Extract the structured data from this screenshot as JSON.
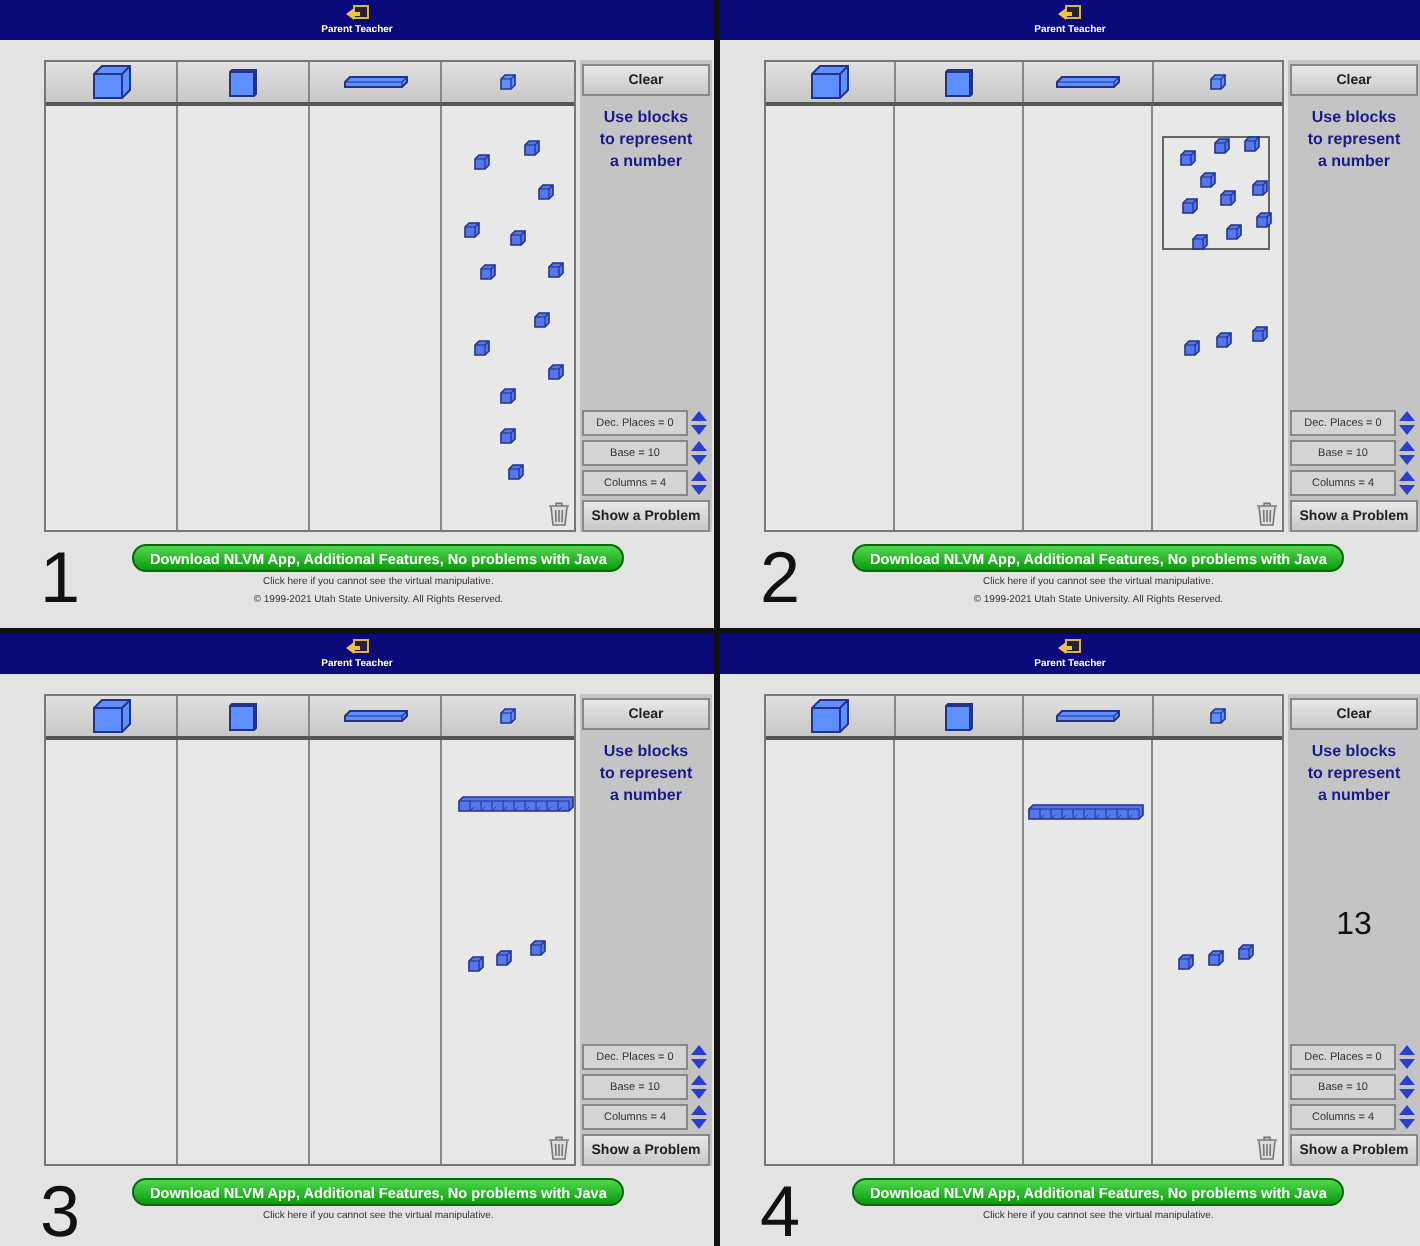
{
  "panels": [
    {
      "label": "1",
      "header": "Parent Teacher",
      "clear_button": "Clear",
      "message": "Use blocks to represent a number",
      "pieces": [
        {
          "kind": "unit"
        },
        {
          "kind": "unit"
        },
        {
          "kind": "unit"
        },
        {
          "kind": "unit"
        },
        {
          "kind": "unit"
        },
        {
          "kind": "unit"
        },
        {
          "kind": "unit"
        },
        {
          "kind": "unit"
        },
        {
          "kind": "unit"
        },
        {
          "kind": "unit"
        },
        {
          "kind": "unit"
        },
        {
          "kind": "unit"
        },
        {
          "kind": "unit"
        }
      ],
      "settings": [
        {
          "label": "Dec. Places = 0"
        },
        {
          "label": "Base = 10"
        },
        {
          "label": "Columns = 4"
        }
      ],
      "problem_button": "Show a Problem",
      "download_button": "Download NLVM App, Additional Features, No problems with Java",
      "notes": [
        "Click here if you cannot see the virtual manipulative.",
        "© 1999-2021 Utah State University. All Rights Reserved."
      ]
    },
    {
      "label": "2",
      "header": "Parent Teacher",
      "clear_button": "Clear",
      "message": "Use blocks to represent a number",
      "selection_box": true,
      "pieces": [
        {
          "kind": "unit"
        },
        {
          "kind": "unit"
        },
        {
          "kind": "unit"
        },
        {
          "kind": "unit"
        },
        {
          "kind": "unit"
        },
        {
          "kind": "unit"
        },
        {
          "kind": "unit"
        },
        {
          "kind": "unit"
        },
        {
          "kind": "unit"
        },
        {
          "kind": "unit"
        },
        {
          "kind": "unit"
        },
        {
          "kind": "unit"
        },
        {
          "kind": "unit"
        }
      ],
      "settings": [
        {
          "label": "Dec. Places = 0"
        },
        {
          "label": "Base = 10"
        },
        {
          "label": "Columns = 4"
        }
      ],
      "problem_button": "Show a Problem",
      "download_button": "Download NLVM App, Additional Features, No problems with Java",
      "notes": [
        "Click here if you cannot see the virtual manipulative.",
        "© 1999-2021 Utah State University. All Rights Reserved."
      ]
    },
    {
      "label": "3",
      "header": "Parent Teacher",
      "clear_button": "Clear",
      "message": "Use blocks to represent a number",
      "pieces": [
        {
          "kind": "rod"
        },
        {
          "kind": "unit"
        },
        {
          "kind": "unit"
        },
        {
          "kind": "unit"
        }
      ],
      "settings": [
        {
          "label": "Dec. Places = 0"
        },
        {
          "label": "Base = 10"
        },
        {
          "label": "Columns = 4"
        }
      ],
      "problem_button": "Show a Problem",
      "download_button": "Download NLVM App, Additional Features, No problems with Java",
      "notes": [
        "Click here if you cannot see the virtual manipulative."
      ]
    },
    {
      "label": "4",
      "header": "Parent Teacher",
      "clear_button": "Clear",
      "message": "Use blocks to represent a number",
      "number": "13",
      "pieces": [
        {
          "kind": "rod"
        },
        {
          "kind": "unit"
        },
        {
          "kind": "unit"
        },
        {
          "kind": "unit"
        }
      ],
      "settings": [
        {
          "label": "Dec. Places = 0"
        },
        {
          "label": "Base = 10"
        },
        {
          "label": "Columns = 4"
        }
      ],
      "problem_button": "Show a Problem",
      "download_button": "Download NLVM App, Additional Features, No problems with Java",
      "notes": [
        "Click here if you cannot see the virtual manipulative."
      ]
    }
  ]
}
